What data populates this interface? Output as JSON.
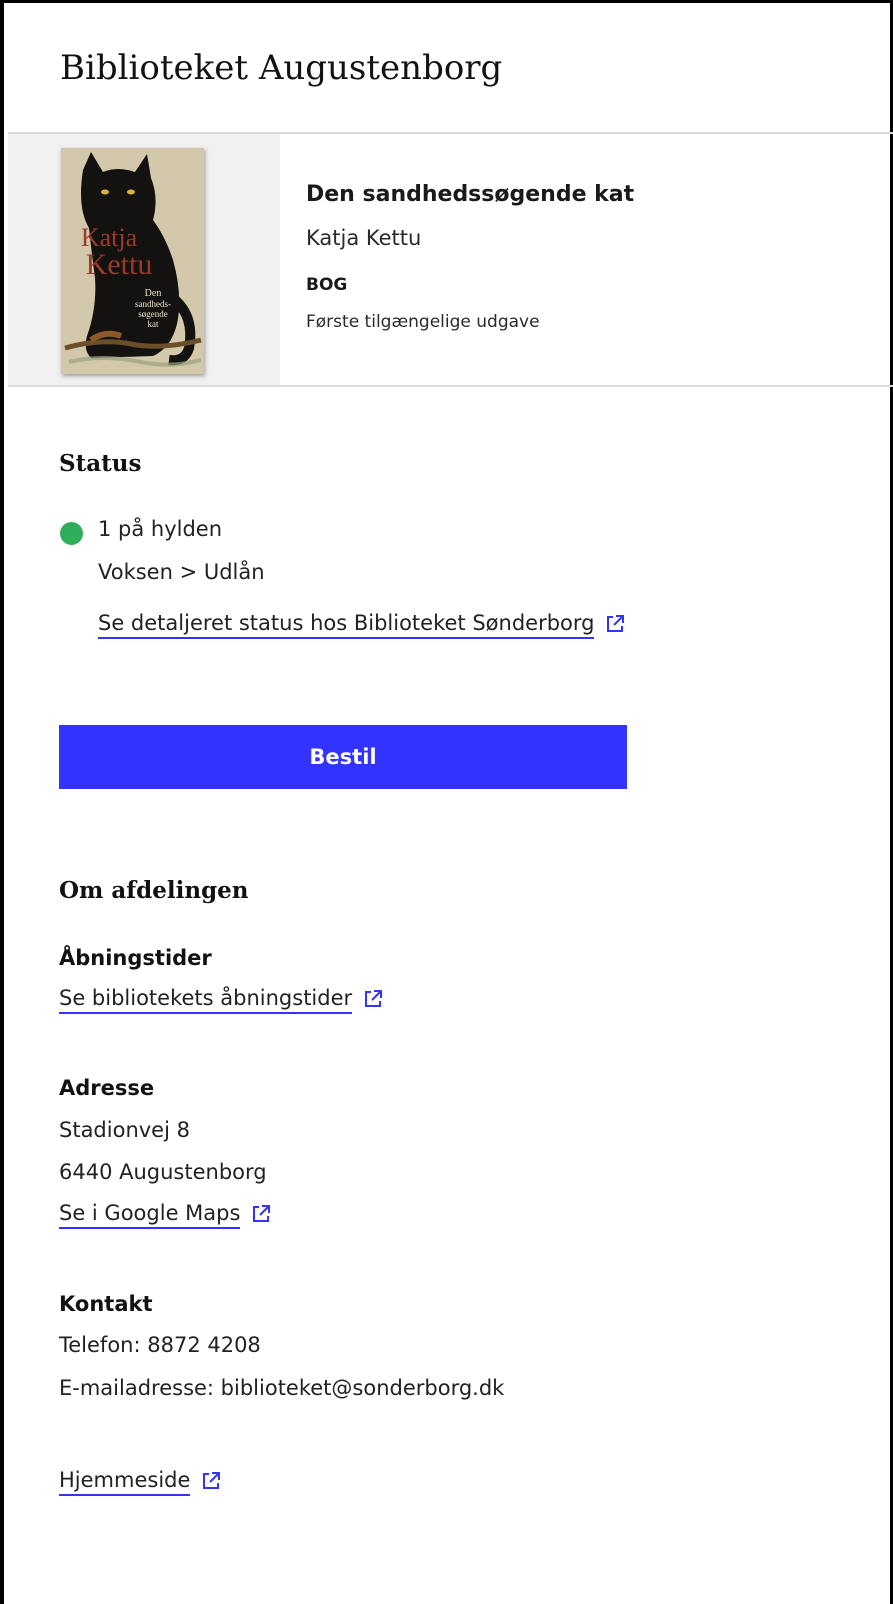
{
  "header": {
    "title": "Biblioteket Augustenborg"
  },
  "book": {
    "cover": {
      "author_first": "Katja",
      "author_last": "Kettu",
      "title_lines": [
        "Den",
        "sandheds-",
        "søgende",
        "kat"
      ],
      "colors": {
        "background": "#d7cdb3",
        "cat": "#141210",
        "author_text": "#9b3a2a",
        "eyes": "#d8b43a"
      }
    },
    "title": "Den sandhedssøgende kat",
    "author": "Katja Kettu",
    "type": "BOG",
    "edition": "Første tilgængelige udgave"
  },
  "status": {
    "heading": "Status",
    "availability": "1 på hylden",
    "location": "Voksen > Udlån",
    "detail_link": "Se detaljeret status hos Biblioteket Sønderborg",
    "dot_color": "#2ead5b"
  },
  "order_button": {
    "label": "Bestil",
    "color": "#3333ff"
  },
  "department": {
    "heading": "Om afdelingen",
    "opening": {
      "label": "Åbningstider",
      "link": "Se bibliotekets åbningstider"
    },
    "address": {
      "label": "Adresse",
      "street": "Stadionvej 8",
      "city": "6440 Augustenborg",
      "map_link": "Se i Google Maps"
    },
    "contact": {
      "label": "Kontakt",
      "phone": "Telefon: 8872 4208",
      "email": "E-mailadresse: biblioteket@sonderborg.dk"
    },
    "homepage_link": "Hjemmeside"
  },
  "icons": {
    "external_link": "external-link-icon"
  }
}
